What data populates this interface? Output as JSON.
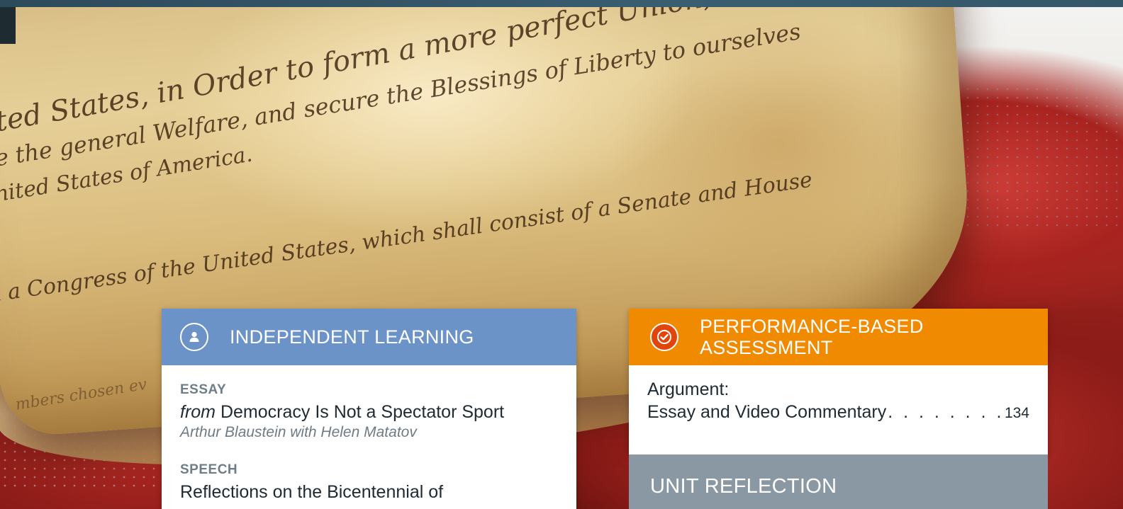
{
  "background": {
    "script_lines": [
      "ted States, in Order to form a more perfect Union, establish Justice,",
      "e the general Welfare, and secure the Blessings of Liberty to ourselves",
      "nited States of America.",
      "n a Congress of the United States, which shall consist of a Senate and House",
      "mbers chosen ev"
    ]
  },
  "independent_learning": {
    "icon": "person-icon",
    "heading": "INDEPENDENT LEARNING",
    "color": "#6c93c8",
    "items": [
      {
        "type": "ESSAY",
        "title_prefix": "from",
        "title": "Democracy Is Not a Spectator Sport",
        "author": "Arthur Blaustein with Helen Matatov"
      },
      {
        "type": "SPEECH",
        "title": "Reflections on the Bicentennial of"
      }
    ]
  },
  "performance_assessment": {
    "icon": "checkmark-icon",
    "heading_line1": "PERFORMANCE-BASED",
    "heading_line2": "ASSESSMENT",
    "color": "#f08a00",
    "entry_line1": "Argument:",
    "entry_line2": "Essay and Video Commentary",
    "leader": ". . . . . . . . ",
    "page": "134"
  },
  "unit_reflection": {
    "heading": "UNIT REFLECTION",
    "color": "#8a98a3"
  }
}
